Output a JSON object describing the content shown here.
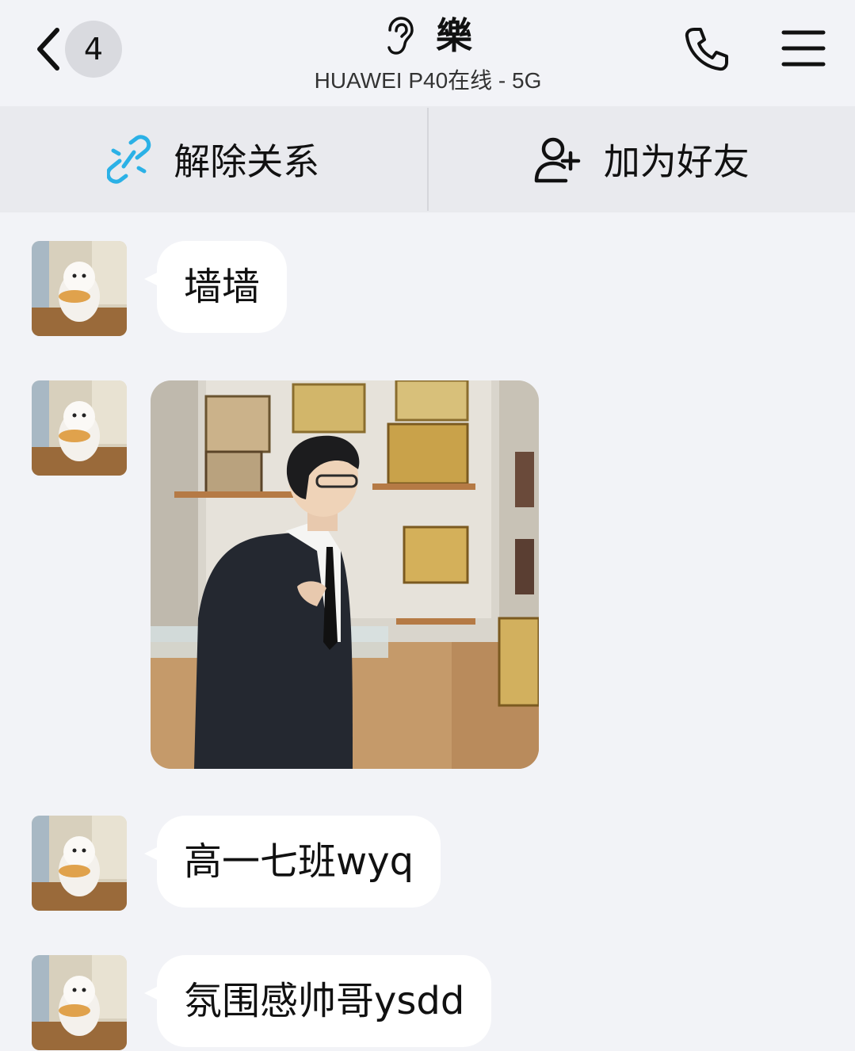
{
  "header": {
    "unread_count": "4",
    "title": "樂",
    "status": "HUAWEI P40在线 - 5G",
    "back_icon": "chevron-left-icon",
    "ear_icon": "ear-icon",
    "phone_icon": "phone-icon",
    "menu_icon": "hamburger-menu-icon"
  },
  "actions": {
    "unlink_label": "解除关系",
    "unlink_icon": "unlink-chain-icon",
    "add_friend_label": "加为好友",
    "add_friend_icon": "add-user-icon"
  },
  "colors": {
    "background": "#f2f3f7",
    "action_bar": "#e9eaee",
    "bubble": "#ffffff",
    "unlink_icon": "#2bb1e6",
    "badge": "#d9dadf"
  },
  "messages": [
    {
      "type": "text",
      "text": "墙墙"
    },
    {
      "type": "image"
    },
    {
      "type": "text",
      "text": "高一七班wyq"
    },
    {
      "type": "text",
      "text": "氛围感帅哥ysdd"
    }
  ]
}
